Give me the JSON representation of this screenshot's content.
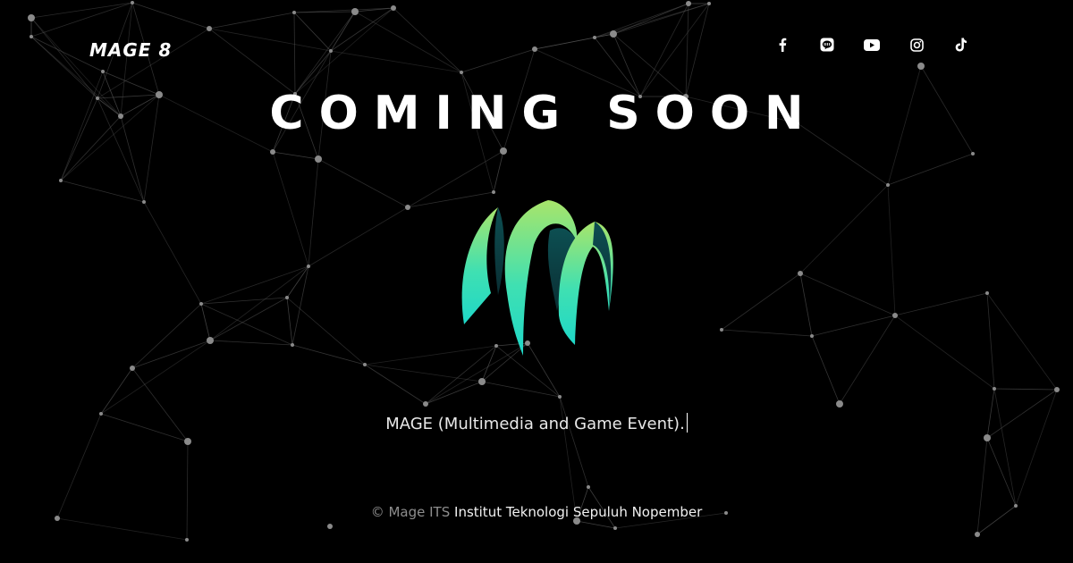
{
  "header": {
    "brand": "MAGE 8",
    "social": [
      {
        "name": "facebook-icon",
        "label": "Facebook"
      },
      {
        "name": "line-icon",
        "label": "LINE"
      },
      {
        "name": "youtube-icon",
        "label": "YouTube"
      },
      {
        "name": "instagram-icon",
        "label": "Instagram"
      },
      {
        "name": "tiktok-icon",
        "label": "TikTok"
      }
    ]
  },
  "main": {
    "title": "COMING SOON",
    "tagline": "MAGE (Multimedia and Game Event)."
  },
  "footer": {
    "copyright": "© Mage ITS",
    "institution": "Institut Teknologi Sepuluh Nopember"
  },
  "colors": {
    "background": "#000000",
    "text": "#ffffff",
    "logo_gradient_top": "#9be36b",
    "logo_gradient_bottom": "#1fd6c4",
    "network_line": "#5a5a5a",
    "network_node": "#8a8a8a"
  }
}
